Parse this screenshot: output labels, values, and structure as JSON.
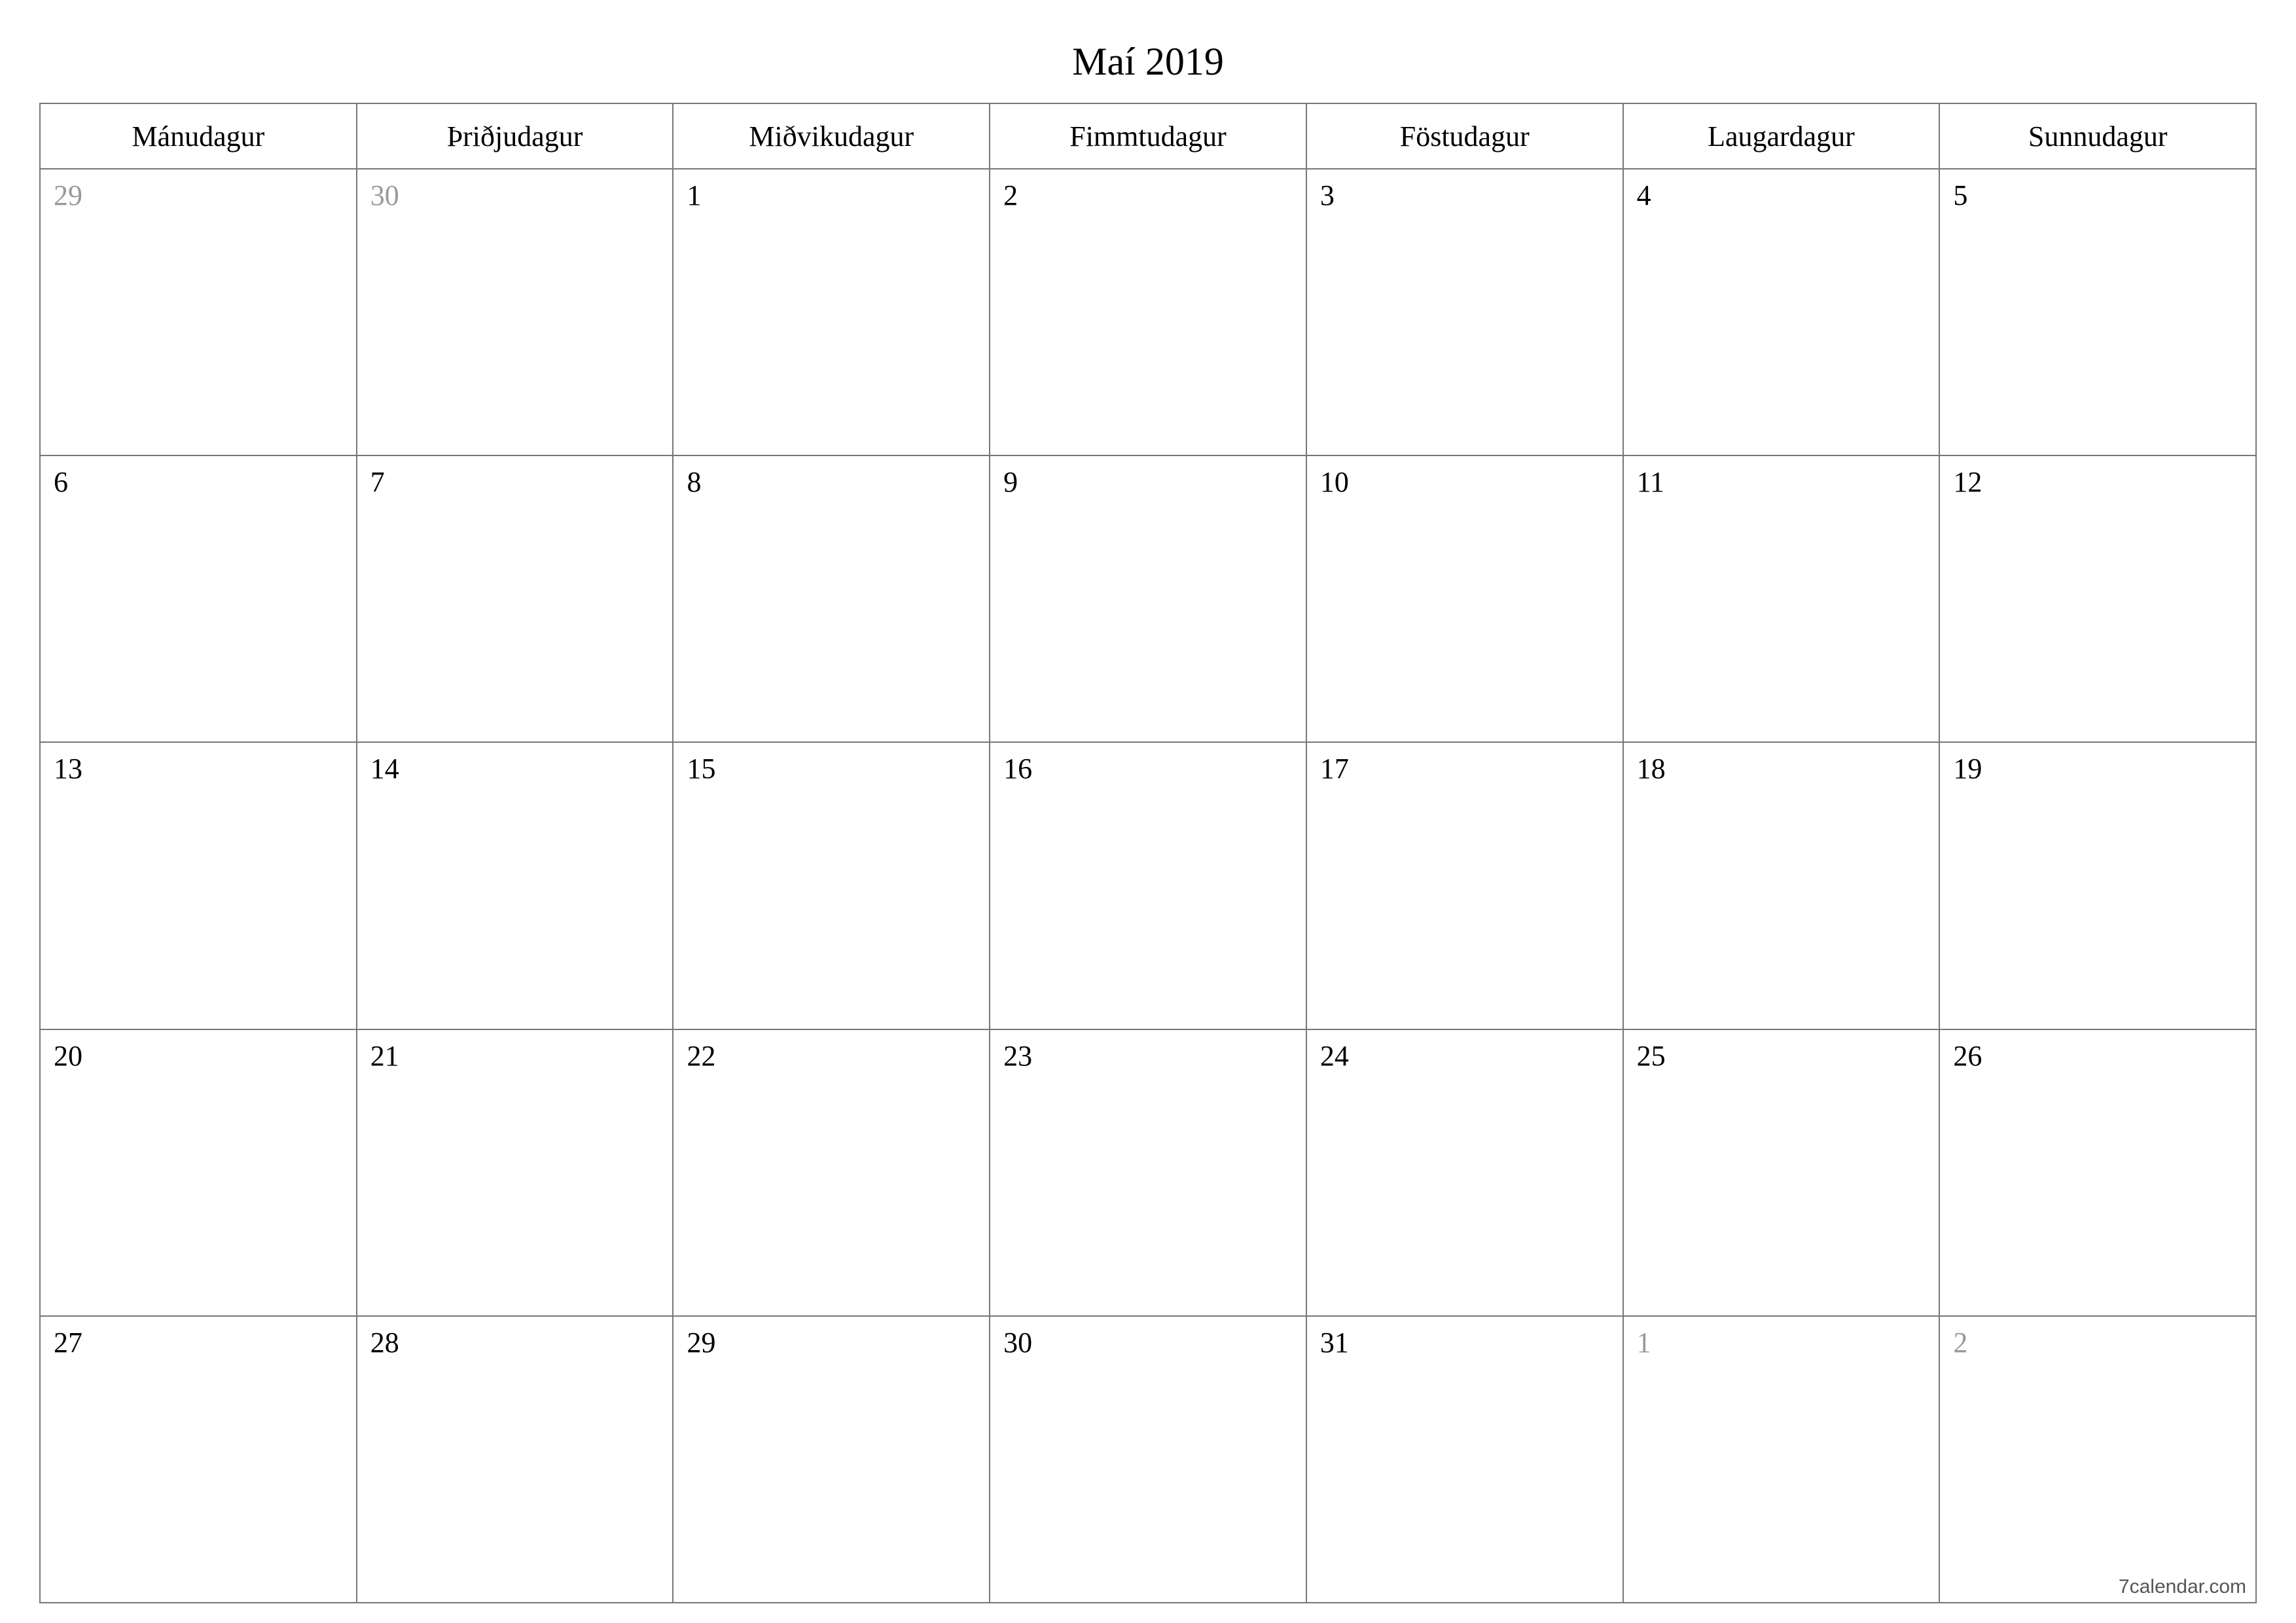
{
  "title": "Maí 2019",
  "weekdays": [
    "Mánudagur",
    "Þriðjudagur",
    "Miðvikudagur",
    "Fimmtudagur",
    "Föstudagur",
    "Laugardagur",
    "Sunnudagur"
  ],
  "weeks": [
    [
      {
        "n": "29",
        "other": true
      },
      {
        "n": "30",
        "other": true
      },
      {
        "n": "1",
        "other": false
      },
      {
        "n": "2",
        "other": false
      },
      {
        "n": "3",
        "other": false
      },
      {
        "n": "4",
        "other": false
      },
      {
        "n": "5",
        "other": false
      }
    ],
    [
      {
        "n": "6",
        "other": false
      },
      {
        "n": "7",
        "other": false
      },
      {
        "n": "8",
        "other": false
      },
      {
        "n": "9",
        "other": false
      },
      {
        "n": "10",
        "other": false
      },
      {
        "n": "11",
        "other": false
      },
      {
        "n": "12",
        "other": false
      }
    ],
    [
      {
        "n": "13",
        "other": false
      },
      {
        "n": "14",
        "other": false
      },
      {
        "n": "15",
        "other": false
      },
      {
        "n": "16",
        "other": false
      },
      {
        "n": "17",
        "other": false
      },
      {
        "n": "18",
        "other": false
      },
      {
        "n": "19",
        "other": false
      }
    ],
    [
      {
        "n": "20",
        "other": false
      },
      {
        "n": "21",
        "other": false
      },
      {
        "n": "22",
        "other": false
      },
      {
        "n": "23",
        "other": false
      },
      {
        "n": "24",
        "other": false
      },
      {
        "n": "25",
        "other": false
      },
      {
        "n": "26",
        "other": false
      }
    ],
    [
      {
        "n": "27",
        "other": false
      },
      {
        "n": "28",
        "other": false
      },
      {
        "n": "29",
        "other": false
      },
      {
        "n": "30",
        "other": false
      },
      {
        "n": "31",
        "other": false
      },
      {
        "n": "1",
        "other": true
      },
      {
        "n": "2",
        "other": true
      }
    ]
  ],
  "attribution": "7calendar.com"
}
